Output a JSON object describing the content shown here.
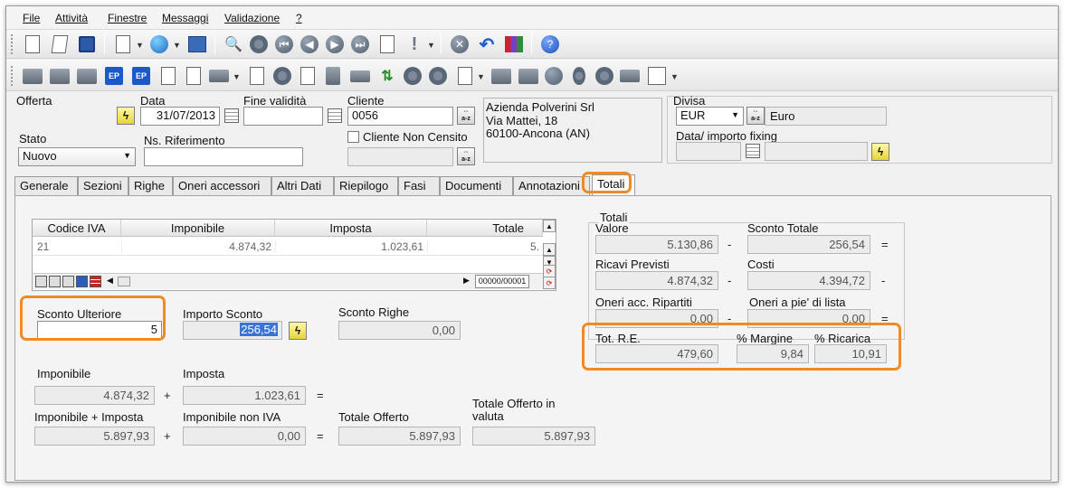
{
  "menu": [
    "File",
    "Attività",
    "Finestre",
    "Messaggi",
    "Validazione",
    "?"
  ],
  "header": {
    "offerta_label": "Offerta",
    "data_label": "Data",
    "data_value": "31/07/2013",
    "fine_validita_label": "Fine validità",
    "fine_validita_value": "",
    "cliente_label": "Cliente",
    "cliente_value": "0056",
    "address_line1": "Azienda Polverini Srl",
    "address_line2": "Via Mattei, 18",
    "address_line3": "60100-Ancona (AN)",
    "divisa_label": "Divisa",
    "divisa_value": "EUR",
    "divisa_desc": "Euro",
    "fixing_label": "Data/ importo fixing",
    "stato_label": "Stato",
    "stato_value": "Nuovo",
    "riferimento_label": "Ns. Riferimento",
    "non_censito_label": "Cliente Non Censito"
  },
  "tabs": [
    "Generale",
    "Sezioni",
    "Righe",
    "Oneri accessori",
    "Altri Dati",
    "Riepilogo",
    "Fasi",
    "Documenti",
    "Annotazioni",
    "Totali"
  ],
  "iva_table": {
    "columns": [
      "Codice IVA",
      "Imponibile",
      "Imposta",
      "Totale"
    ],
    "rows": [
      [
        "21",
        "4.874,32",
        "1.023,61",
        "5."
      ]
    ],
    "counter": "00000/00001"
  },
  "sconti": {
    "ulteriore_label": "Sconto Ulteriore",
    "ulteriore_value": "5",
    "importo_label": "Importo Sconto",
    "importo_value": "256,54",
    "righe_label": "Sconto Righe",
    "righe_value": "0,00"
  },
  "summary": {
    "imponibile_label": "Imponibile",
    "imponibile_value": "4.874,32",
    "imposta_label": "Imposta",
    "imposta_value": "1.023,61",
    "imp_imposta_label": "Imponibile + Imposta",
    "imp_imposta_value": "5.897,93",
    "non_iva_label": "Imponibile non IVA",
    "non_iva_value": "0,00",
    "offerto_label": "Totale Offerto",
    "offerto_value": "5.897,93",
    "valuta_label": "Totale Offerto in valuta",
    "valuta_value": "5.897,93",
    "plus": "+",
    "equals": "="
  },
  "totali": {
    "group_label": "Totali",
    "valore_label": "Valore",
    "valore_value": "5.130,86",
    "sconto_totale_label": "Sconto Totale",
    "sconto_totale_value": "256,54",
    "ricavi_label": "Ricavi Previsti",
    "ricavi_value": "4.874,32",
    "costi_label": "Costi",
    "costi_value": "4.394,72",
    "oneri_rip_label": "Oneri acc. Ripartiti",
    "oneri_rip_value": "0,00",
    "oneri_piede_label": "Oneri a pie' di lista",
    "oneri_piede_value": "0,00",
    "tot_re_label": "Tot. R.E.",
    "tot_re_value": "479,60",
    "margine_label": "% Margine",
    "margine_value": "9,84",
    "ricarica_label": "% Ricarica",
    "ricarica_value": "10,91",
    "minus": "-",
    "equals": "="
  },
  "colors": {
    "highlight": "#f08a24",
    "selection": "#3875d7"
  }
}
